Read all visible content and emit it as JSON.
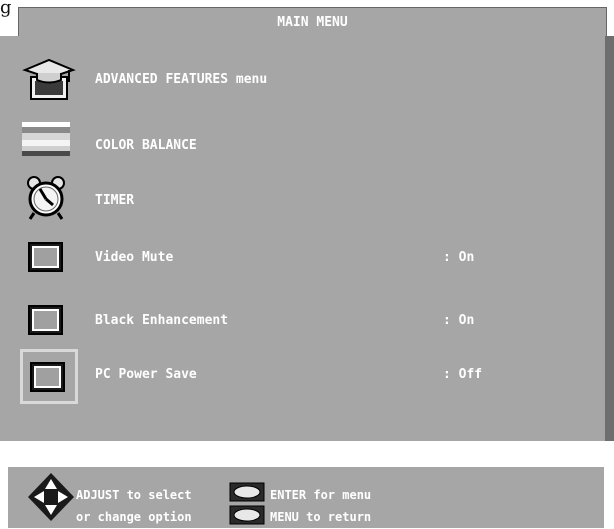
{
  "corner_glyph": "g",
  "title": "MAIN MENU",
  "items": [
    {
      "label": "ADVANCED FEATURES menu",
      "value": "",
      "icon": "graduation-cap-icon"
    },
    {
      "label": "COLOR BALANCE",
      "value": "",
      "icon": "color-bars-icon"
    },
    {
      "label": "TIMER",
      "value": "",
      "icon": "alarm-clock-icon"
    },
    {
      "label": "Video Mute",
      "value": ": On",
      "icon": "toggle-box-icon"
    },
    {
      "label": "Black Enhancement",
      "value": ": On",
      "icon": "toggle-box-icon"
    },
    {
      "label": "PC Power Save",
      "value": ": Off",
      "icon": "toggle-box-icon",
      "selected": true
    }
  ],
  "footer": {
    "adjust_line1": "ADJUST to select",
    "adjust_line2": "or change option",
    "enter_text": "ENTER for menu",
    "menu_text": "MENU to return",
    "icons": [
      "dpad-icon",
      "enter-button-icon",
      "menu-button-icon"
    ]
  },
  "colors": {
    "panel": "#a6a6a6",
    "shadow": "#6e6e6e",
    "text": "#ffffff",
    "highlight": "#d9d9d9"
  }
}
